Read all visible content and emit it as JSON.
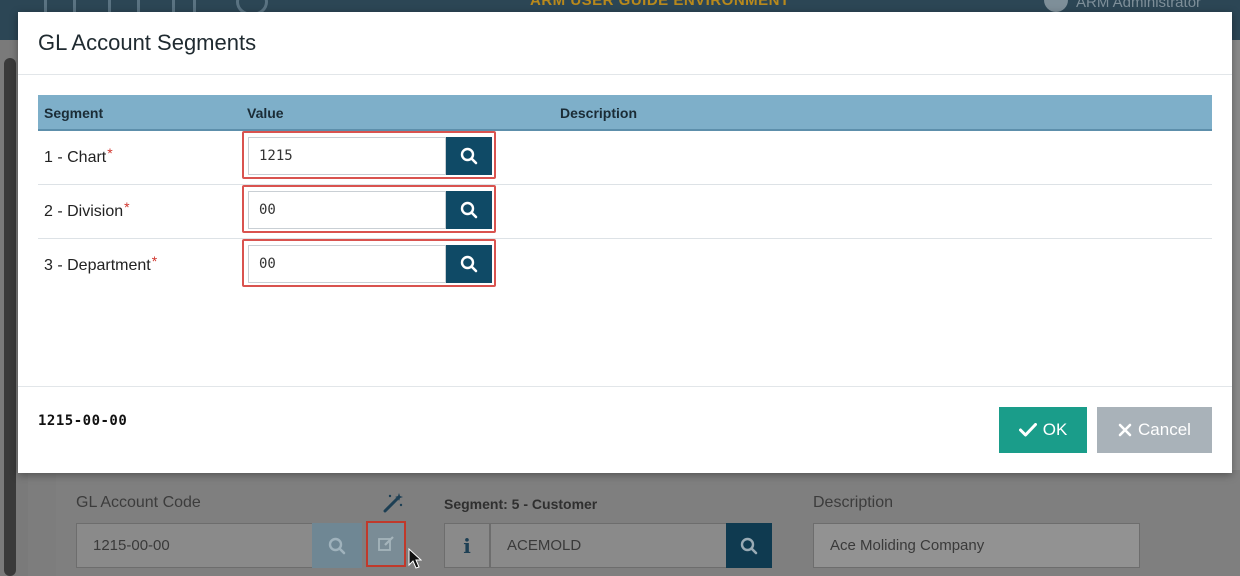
{
  "app": {
    "environment_title": "ARM USER GUIDE ENVIRONMENT",
    "user_name": "ARM Administrator"
  },
  "background_form": {
    "gl_account_code_label": "GL Account Code",
    "gl_account_code_value": "1215-00-00",
    "segment_label": "Segment: 5 - Customer",
    "segment_value": "ACEMOLD",
    "info_glyph": "i",
    "description_label": "Description",
    "description_value": "Ace Moliding Company"
  },
  "modal": {
    "title": "GL Account Segments",
    "columns": {
      "segment": "Segment",
      "value": "Value",
      "description": "Description"
    },
    "rows": [
      {
        "segment": "1 - Chart",
        "required_mark": "*",
        "value": "1215",
        "description": ""
      },
      {
        "segment": "2 - Division",
        "required_mark": "*",
        "value": "00",
        "description": ""
      },
      {
        "segment": "3 - Department",
        "required_mark": "*",
        "value": "00",
        "description": ""
      }
    ],
    "summary": "1215-00-00",
    "ok_label": "OK",
    "cancel_label": "Cancel"
  },
  "colors": {
    "topbar": "#2c4655",
    "grid_header": "#7eafc9",
    "search_button": "#0f4a66",
    "ok_button": "#1a9d8a",
    "cancel_button": "#a9b2b9",
    "highlight_border": "#d9534f",
    "required": "#d0342c"
  },
  "icons": {
    "search": "search-icon",
    "check": "check-icon",
    "close": "close-icon",
    "edit": "edit-icon",
    "magic_wand": "magic-wand-icon",
    "info": "info-icon"
  }
}
